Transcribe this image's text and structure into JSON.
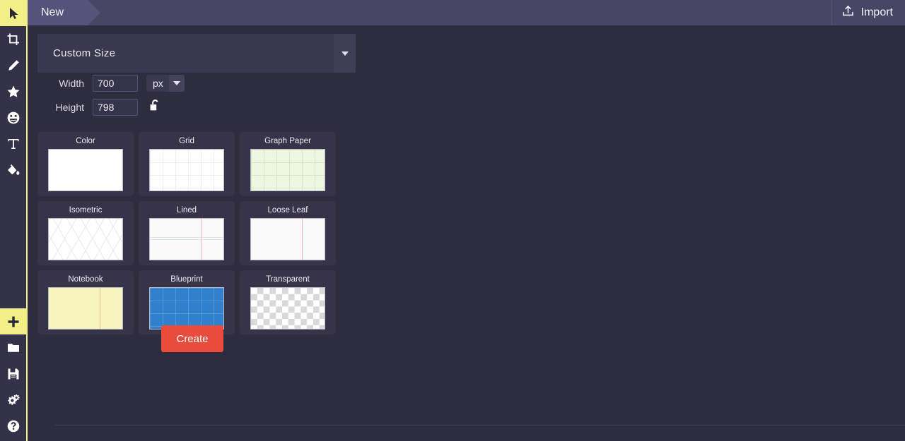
{
  "app": {
    "accent_yellow": "#f2ef87",
    "accent_red": "#ea4c3b",
    "topbar_color": "#484665",
    "panel_color": "#2e2c3f"
  },
  "toolbar": {
    "items": [
      {
        "name": "select-tool",
        "icon": "cursor-arrow-icon",
        "active": true
      },
      {
        "name": "crop-tool",
        "icon": "crop-icon",
        "active": false
      },
      {
        "name": "pencil-tool",
        "icon": "pencil-icon",
        "active": false
      },
      {
        "name": "shape-tool",
        "icon": "star-icon",
        "active": false
      },
      {
        "name": "sticker-tool",
        "icon": "smiley-icon",
        "active": false
      },
      {
        "name": "text-tool",
        "icon": "text-t-icon",
        "active": false
      },
      {
        "name": "fill-tool",
        "icon": "paint-bucket-icon",
        "active": false
      }
    ],
    "bottom_items": [
      {
        "name": "new-button",
        "icon": "plus-icon",
        "active": true
      },
      {
        "name": "open-button",
        "icon": "folder-icon",
        "active": false
      },
      {
        "name": "save-button",
        "icon": "floppy-disk-icon",
        "active": false
      },
      {
        "name": "settings-button",
        "icon": "gears-icon",
        "active": false
      },
      {
        "name": "help-button",
        "icon": "question-mark-circle-icon",
        "active": false
      }
    ]
  },
  "topbar": {
    "tabs": [
      {
        "label": "New",
        "active": true
      }
    ],
    "import_label": "Import",
    "import_icon": "import-upload-icon"
  },
  "panel": {
    "size_preset": {
      "selected": "Custom Size",
      "options": [
        "Custom Size"
      ]
    },
    "width": {
      "label": "Width",
      "value": "700"
    },
    "height": {
      "label": "Height",
      "value": "798"
    },
    "unit": {
      "selected": "px",
      "options": [
        "px"
      ]
    },
    "lock_aspect": {
      "icon": "unlocked-padlock-icon",
      "locked": false
    },
    "create_label": "Create",
    "templates": [
      {
        "name": "color",
        "label": "Color",
        "style": "th-color"
      },
      {
        "name": "grid",
        "label": "Grid",
        "style": "th-grid"
      },
      {
        "name": "graph-paper",
        "label": "Graph Paper",
        "style": "th-graph"
      },
      {
        "name": "isometric",
        "label": "Isometric",
        "style": "th-iso"
      },
      {
        "name": "lined",
        "label": "Lined",
        "style": "th-lined"
      },
      {
        "name": "loose-leaf",
        "label": "Loose Leaf",
        "style": "th-loose"
      },
      {
        "name": "notebook",
        "label": "Notebook",
        "style": "th-notebook"
      },
      {
        "name": "blueprint",
        "label": "Blueprint",
        "style": "th-blueprint"
      },
      {
        "name": "transparent",
        "label": "Transparent",
        "style": "th-transparent"
      }
    ]
  }
}
